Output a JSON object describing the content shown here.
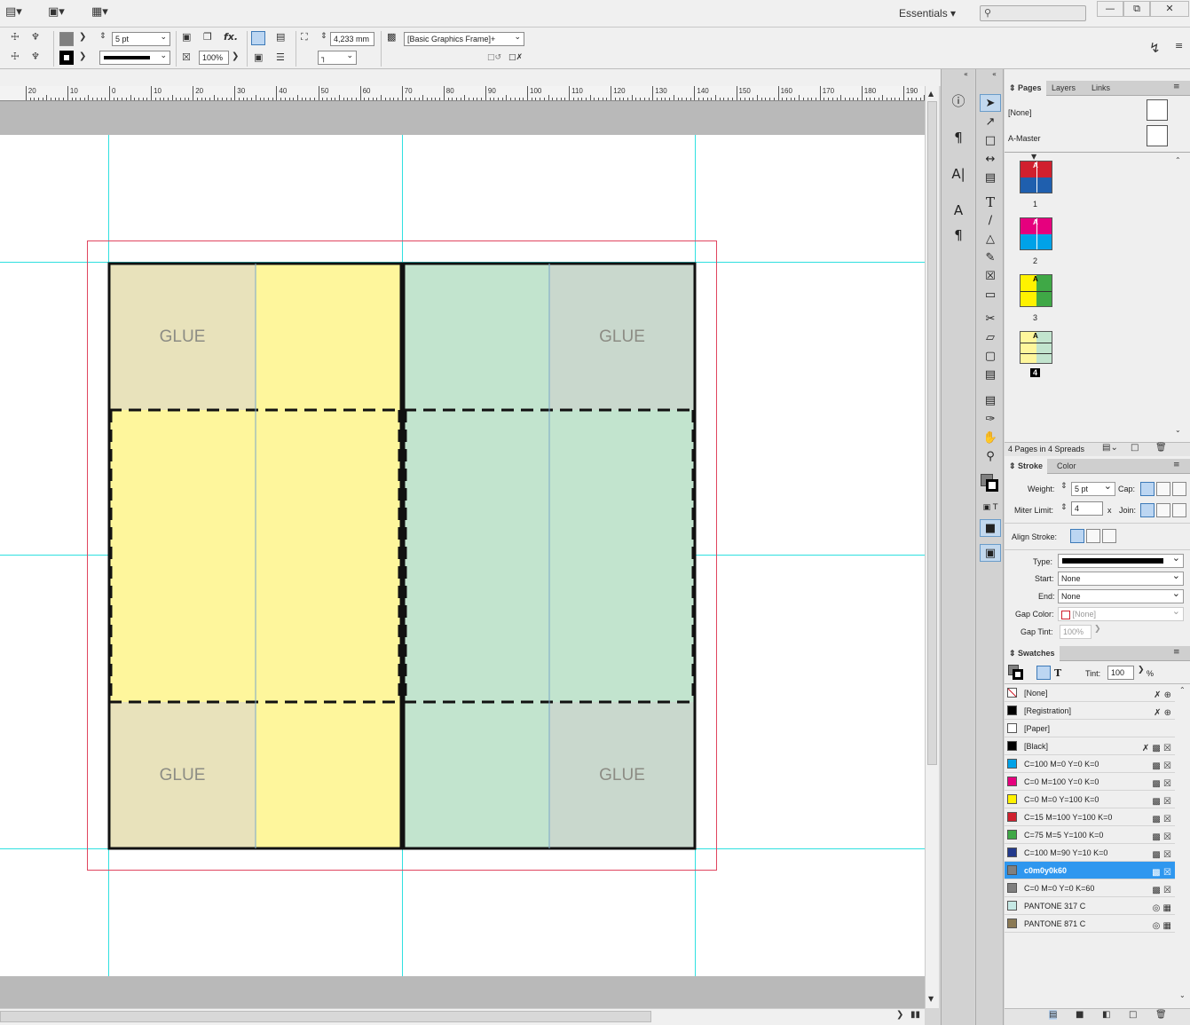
{
  "appbar": {
    "workspace": "Essentials",
    "min_icon": "minimize-icon",
    "restore_icon": "restore-icon",
    "close_icon": "close-icon"
  },
  "control": {
    "stroke_weight": "5 pt",
    "scale": "100%",
    "dimension": "4,233 mm",
    "object_style": "[Basic Graphics Frame]+"
  },
  "ruler": {
    "labels": [
      "20",
      "10",
      "0",
      "10",
      "20",
      "30",
      "40",
      "50",
      "60",
      "70",
      "80",
      "90",
      "100",
      "110",
      "120",
      "130",
      "140",
      "150",
      "160",
      "170",
      "180",
      "190"
    ]
  },
  "canvas": {
    "glue_label": "GLUE",
    "colors": {
      "yellow": "#fef69c",
      "green": "#c2e4ce",
      "glue_yellow": "#e8e2bb",
      "glue_green": "#c9d8cd"
    }
  },
  "pages_panel": {
    "tabs": [
      "Pages",
      "Layers",
      "Links"
    ],
    "masters": [
      "[None]",
      "A-Master"
    ],
    "pages": [
      "1",
      "2",
      "3",
      "4"
    ],
    "footer": "4 Pages in 4 Spreads"
  },
  "stroke_panel": {
    "tabs": [
      "Stroke",
      "Color"
    ],
    "weight_label": "Weight:",
    "weight": "5 pt",
    "cap_label": "Cap:",
    "miter_label": "Miter Limit:",
    "miter": "4",
    "miter_x": "x",
    "join_label": "Join:",
    "align_label": "Align Stroke:",
    "type_label": "Type:",
    "start_label": "Start:",
    "start": "None",
    "end_label": "End:",
    "end": "None",
    "gap_color_label": "Gap Color:",
    "gap_color": "[None]",
    "gap_tint_label": "Gap Tint:",
    "gap_tint": "100%"
  },
  "swatches_panel": {
    "title": "Swatches",
    "tint_label": "Tint:",
    "tint": "100",
    "percent": "%",
    "items": [
      {
        "name": "[None]",
        "color": "#ffffff"
      },
      {
        "name": "[Registration]",
        "color": "#000000"
      },
      {
        "name": "[Paper]",
        "color": "#ffffff"
      },
      {
        "name": "[Black]",
        "color": "#000000"
      },
      {
        "name": "C=100 M=0 Y=0 K=0",
        "color": "#00a2e8"
      },
      {
        "name": "C=0 M=100 Y=0 K=0",
        "color": "#e6007e"
      },
      {
        "name": "C=0 M=0 Y=100 K=0",
        "color": "#fff200"
      },
      {
        "name": "C=15 M=100 Y=100 K=0",
        "color": "#d0202e"
      },
      {
        "name": "C=75 M=5 Y=100 K=0",
        "color": "#3fa846"
      },
      {
        "name": "C=100 M=90 Y=10 K=0",
        "color": "#233a8c"
      },
      {
        "name": "c0m0y0k60",
        "color": "#808080"
      },
      {
        "name": "C=0 M=0 Y=0 K=60",
        "color": "#808080"
      },
      {
        "name": "PANTONE 317 C",
        "color": "#c6e9e5"
      },
      {
        "name": "PANTONE 871 C",
        "color": "#8b7a55"
      }
    ]
  }
}
